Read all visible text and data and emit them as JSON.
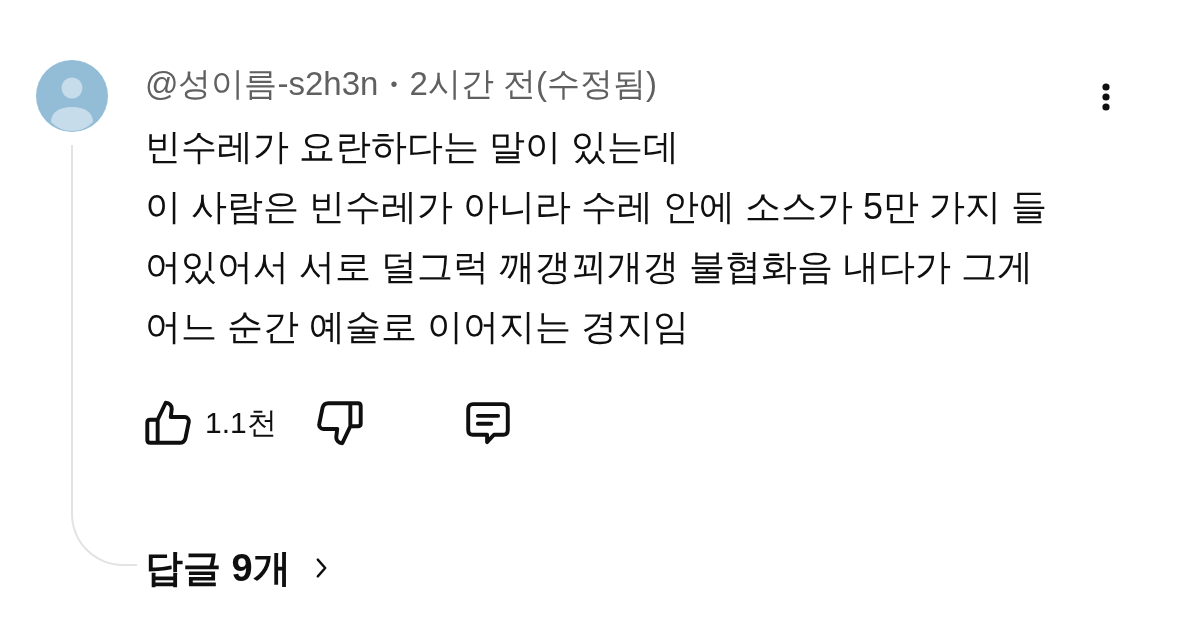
{
  "comment": {
    "author": "@성이름-s2h3n",
    "separator": "•",
    "time": "2시간 전(수정됨)",
    "text": "빈수레가 요란하다는 말이 있는데\n이 사람은 빈수레가 아니라 수레 안에 소스가 5만 가지 들어있어서 서로 덜그럭 깨갱꾀개갱 불협화음 내다가 그게 어느 순간 예술로 이어지는 경지임",
    "likes": "1.1천",
    "replies": "답글 9개"
  }
}
